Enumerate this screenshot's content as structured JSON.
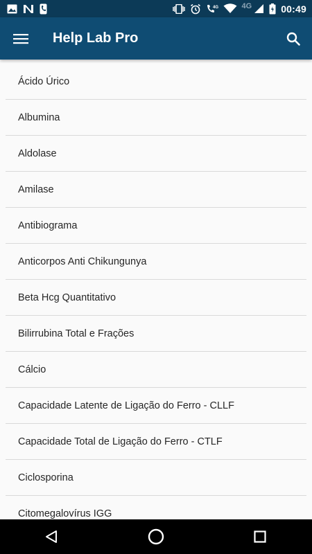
{
  "status_bar": {
    "time": "00:49",
    "network": "4G",
    "icons_left": [
      "image-icon",
      "n-notification-icon",
      "phone-notification-icon"
    ],
    "icons_right": [
      "vibrate-icon",
      "alarm-icon",
      "volte-call-icon",
      "wifi-icon",
      "signal-icon",
      "battery-icon"
    ]
  },
  "app_bar": {
    "title": "Help Lab Pro",
    "menu_icon": "hamburger-menu-icon",
    "search_icon": "search-icon",
    "background": "#0f4c73"
  },
  "list": {
    "items": [
      "Ácido Úrico",
      "Albumina",
      "Aldolase",
      "Amilase",
      "Antibiograma",
      "Anticorpos Anti Chikungunya",
      "Beta Hcg Quantitativo",
      "Bilirrubina Total e Frações",
      "Cálcio",
      "Capacidade Latente de Ligação do Ferro - CLLF",
      "Capacidade Total de Ligação do Ferro - CTLF",
      "Ciclosporina",
      "Citomegalovírus IGG"
    ]
  },
  "nav_bar": {
    "buttons": [
      "back-icon",
      "home-icon",
      "recents-icon"
    ]
  }
}
